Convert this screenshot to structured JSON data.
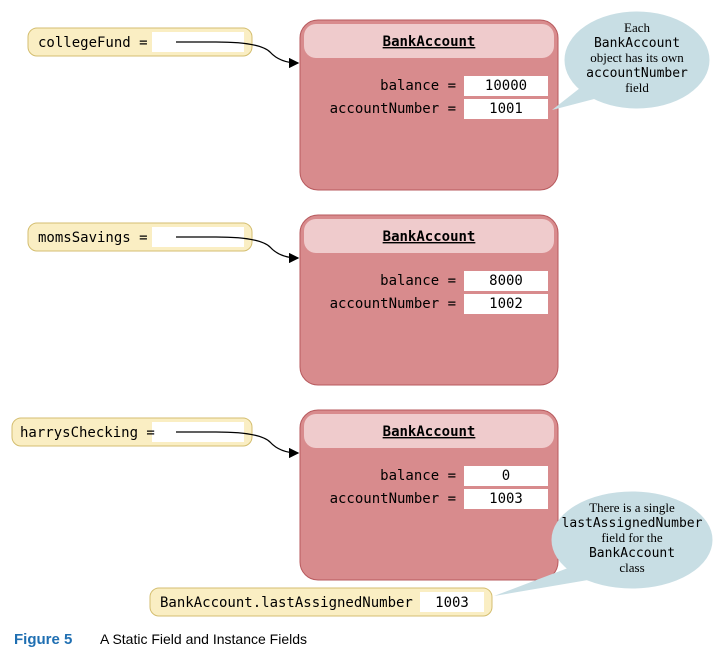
{
  "object1": {
    "varName": "collegeFund =",
    "className": "BankAccount",
    "balanceLabel": "balance =",
    "accountLabel": "accountNumber =",
    "balanceValue": "10000",
    "accountValue": "1001"
  },
  "object2": {
    "varName": "momsSavings =",
    "className": "BankAccount",
    "balanceLabel": "balance =",
    "accountLabel": "accountNumber =",
    "balanceValue": "8000",
    "accountValue": "1002"
  },
  "object3": {
    "varName": "harrysChecking =",
    "className": "BankAccount",
    "balanceLabel": "balance =",
    "accountLabel": "accountNumber =",
    "balanceValue": "0",
    "accountValue": "1003"
  },
  "staticField": {
    "label": "BankAccount.lastAssignedNumber =",
    "value": "1003"
  },
  "bubble1": {
    "l1": "Each",
    "l2": "BankAccount",
    "l3": "object has its own",
    "l4": "accountNumber",
    "l5": "field"
  },
  "bubble2": {
    "l1": "There is a single",
    "l2": "lastAssignedNumber",
    "l3": "field for the",
    "l4": "BankAccount",
    "l5": "class"
  },
  "caption": {
    "num": "Figure 5",
    "text": "A Static Field and Instance Fields"
  }
}
